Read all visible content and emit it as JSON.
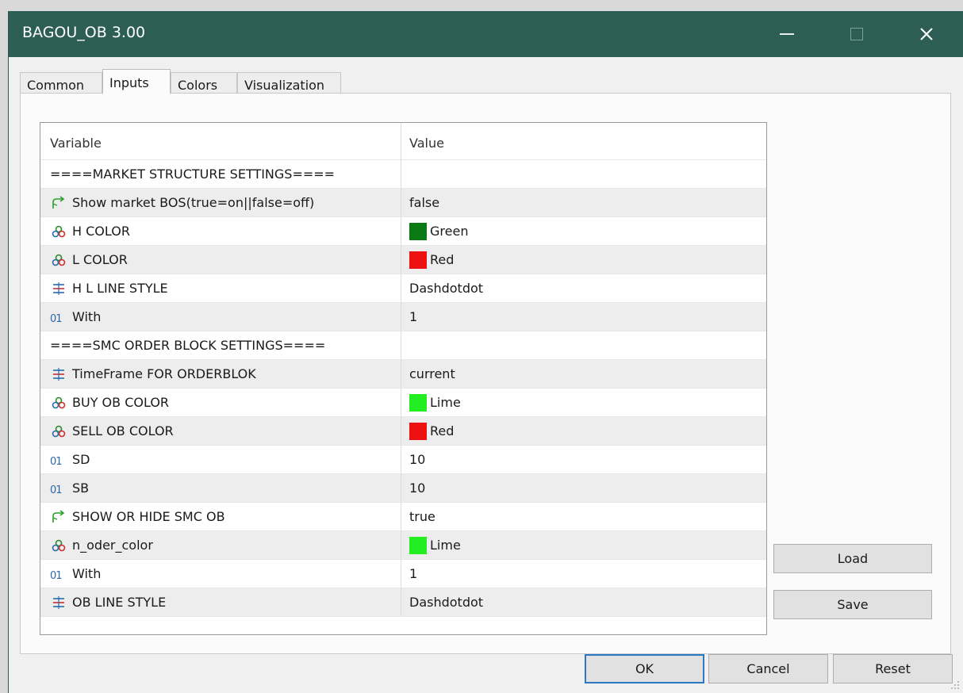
{
  "window": {
    "title": "BAGOU_OB 3.00"
  },
  "tabs": [
    {
      "label": "Common",
      "active": false
    },
    {
      "label": "Inputs",
      "active": true
    },
    {
      "label": "Colors",
      "active": false
    },
    {
      "label": "Visualization",
      "active": false
    }
  ],
  "grid": {
    "headers": {
      "variable": "Variable",
      "value": "Value"
    },
    "rows": [
      {
        "icon": "none",
        "variable": "====MARKET STRUCTURE SETTINGS====",
        "value": ""
      },
      {
        "icon": "bool-arrow-icon",
        "variable": "Show market BOS(true=on||false=off)",
        "value": "false"
      },
      {
        "icon": "color-icon",
        "variable": "H COLOR",
        "value": "Green",
        "swatch": "#0b7a14"
      },
      {
        "icon": "color-icon",
        "variable": "L COLOR",
        "value": "Red",
        "swatch": "#ee1111"
      },
      {
        "icon": "enum-icon",
        "variable": "H L LINE STYLE",
        "value": "Dashdotdot"
      },
      {
        "icon": "int-icon",
        "variable": "With",
        "value": "1"
      },
      {
        "icon": "none",
        "variable": "====SMC ORDER BLOCK SETTINGS====",
        "value": ""
      },
      {
        "icon": "enum-icon",
        "variable": "TimeFrame FOR ORDERBLOK",
        "value": "current"
      },
      {
        "icon": "color-icon",
        "variable": "BUY OB COLOR",
        "value": "Lime",
        "swatch": "#22ee22"
      },
      {
        "icon": "color-icon",
        "variable": "SELL OB COLOR",
        "value": "Red",
        "swatch": "#ee1111"
      },
      {
        "icon": "int-icon",
        "variable": "SD",
        "value": "10"
      },
      {
        "icon": "int-icon",
        "variable": "SB",
        "value": "10"
      },
      {
        "icon": "bool-arrow-icon",
        "variable": "SHOW OR HIDE SMC OB",
        "value": "true"
      },
      {
        "icon": "color-icon",
        "variable": "n_oder_color",
        "value": "Lime",
        "swatch": "#22ee22"
      },
      {
        "icon": "int-icon",
        "variable": "With",
        "value": "1"
      },
      {
        "icon": "enum-icon",
        "variable": "OB LINE STYLE",
        "value": "Dashdotdot"
      }
    ]
  },
  "buttons": {
    "load": "Load",
    "save": "Save",
    "ok": "OK",
    "cancel": "Cancel",
    "reset": "Reset"
  },
  "int_icon_text": "01",
  "colors": {
    "titlebar": "#2d5e56",
    "ok_border": "#2d78c4"
  }
}
